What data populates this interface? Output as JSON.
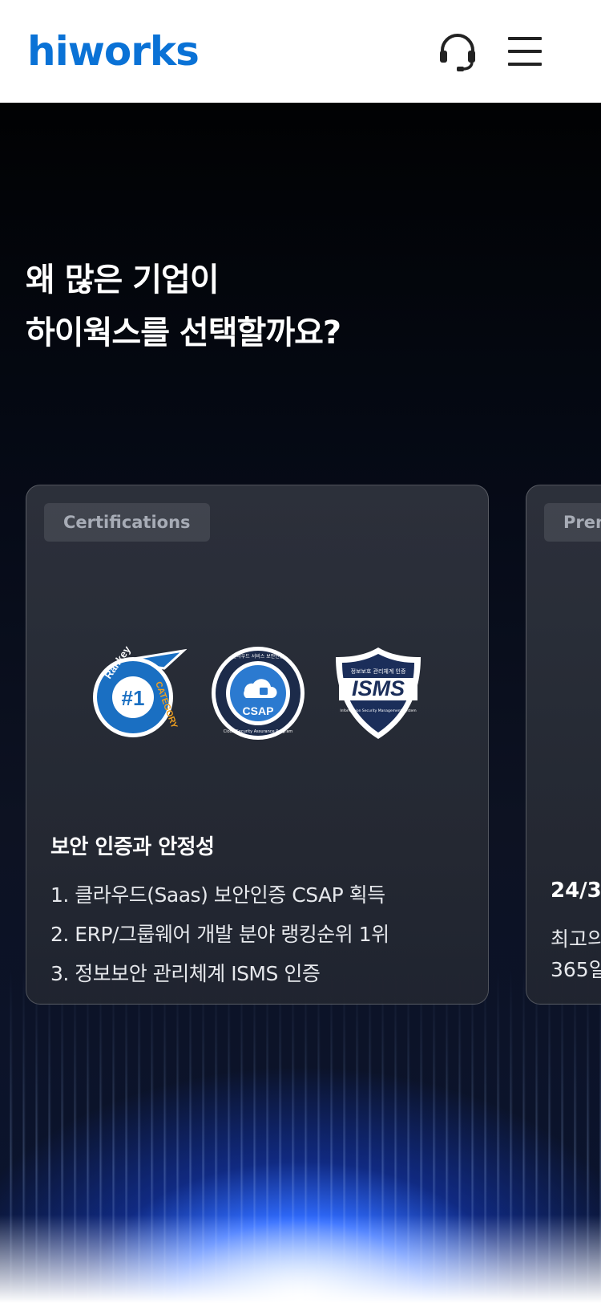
{
  "header": {
    "logo": "hiworks",
    "support_icon": "headset-icon",
    "menu_icon": "hamburger-menu-icon"
  },
  "hero": {
    "title_line1": "왜 많은 기업이",
    "title_line2": "하이웍스를 선택할까요?"
  },
  "cards": [
    {
      "tag": "Certifications",
      "badges": [
        {
          "icon": "rankey-category-badge",
          "label_top": "Rankey",
          "label_mid": "#1",
          "label_side": "CATEGORY"
        },
        {
          "icon": "csap-badge",
          "label_top": "클라우드 서비스 보안인증",
          "label_mid": "CSAP",
          "label_bottom": "Cloud Security Assurance Program"
        },
        {
          "icon": "isms-shield-badge",
          "label_top": "정보보호 관리체계 인증",
          "label_mid": "ISMS",
          "label_bottom": "Information Security Management System"
        }
      ],
      "heading": "보안 인증과 안정성",
      "items": [
        "1. 클라우드(Saas) 보안인증 CSAP 획득",
        "2. ERP/그룹웨어 개발 분야 랭킹순위 1위",
        "3. 정보보안 관리체계 ISMS 인증"
      ]
    },
    {
      "tag": "Pren",
      "heading": "24/3",
      "line1": "최고의",
      "line2": "365일"
    }
  ],
  "colors": {
    "brand": "#0a72d6",
    "hero_bg": "#010203",
    "glow": "#2f6bff"
  }
}
